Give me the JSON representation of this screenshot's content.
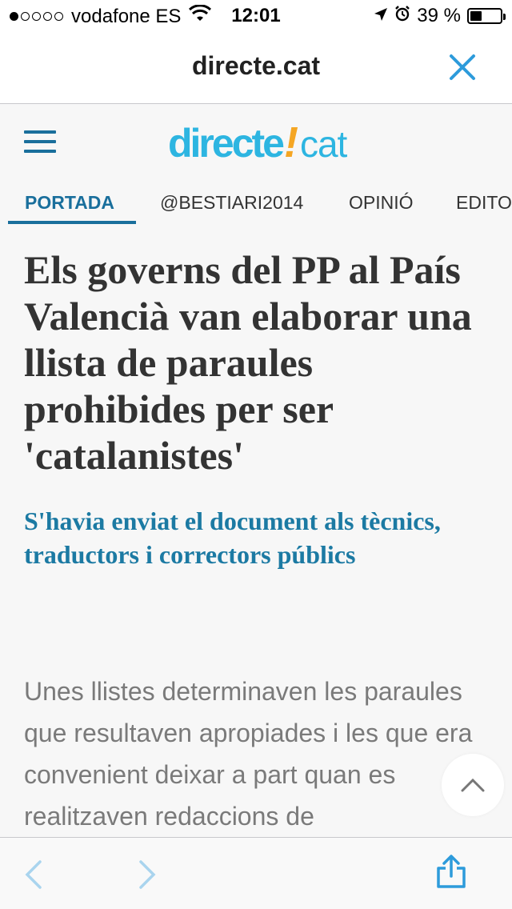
{
  "status_bar": {
    "carrier": "vodafone ES",
    "time": "12:01",
    "battery_percent_label": "39 %",
    "battery_level": 0.39,
    "signal_bars_filled": 1,
    "signal_bars_total": 5,
    "icons": [
      "wifi-icon",
      "location-arrow-icon",
      "alarm-icon",
      "battery-icon"
    ]
  },
  "browser": {
    "domain": "directe.cat",
    "close_icon": "close-icon",
    "accent_color": "#2d9bdb"
  },
  "site": {
    "logo": "directe!cat",
    "logo_main": "directe",
    "logo_bang": "!",
    "logo_tld": "cat",
    "menu_icon": "hamburger-menu-icon",
    "brand_colors": {
      "primary": "#1a6f9c",
      "logo_blue": "#2db5e1",
      "logo_orange": "#f5a623"
    }
  },
  "nav": {
    "tabs": [
      {
        "label": "PORTADA",
        "active": true
      },
      {
        "label": "@BESTIARI2014",
        "active": false
      },
      {
        "label": "OPINIÓ",
        "active": false
      },
      {
        "label": "EDITO",
        "active": false
      }
    ]
  },
  "article": {
    "headline": "Els governs del PP al País Valencià van elaborar una llista de paraules prohibides per ser 'catalanistes'",
    "subheadline": "S'havia enviat el document als tècnics, traductors i correctors públics",
    "body": "Unes llistes determinaven les paraules que resultaven apropiades i les que era convenient deixar a part quan es realitzaven redaccions de"
  },
  "scroll_top": {
    "icon": "chevron-up-icon"
  },
  "toolbar": {
    "back_icon": "chevron-left-icon",
    "forward_icon": "chevron-right-icon",
    "share_icon": "share-icon"
  }
}
